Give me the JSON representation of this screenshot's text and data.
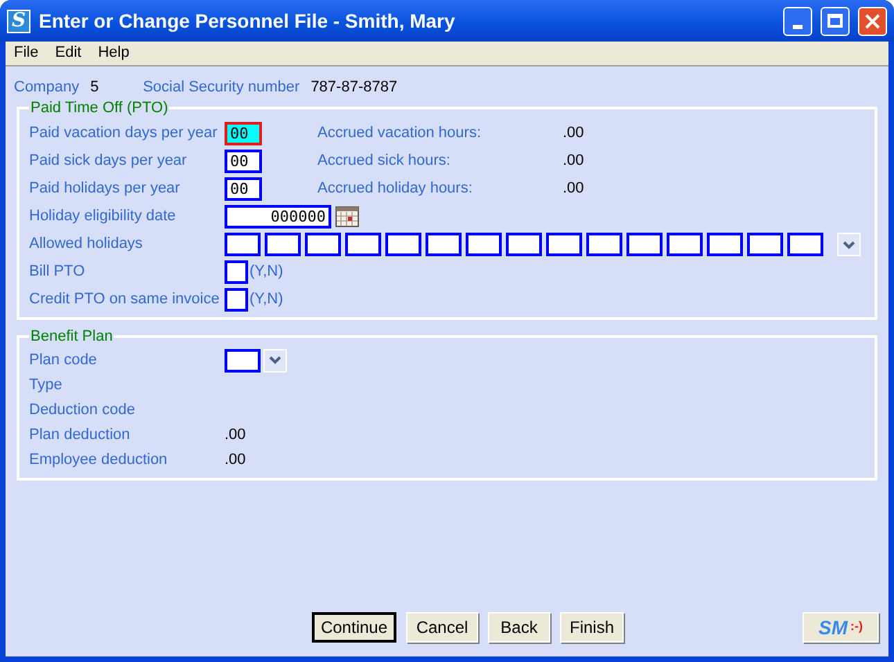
{
  "window": {
    "icon_letter": "S",
    "title": "Enter or Change Personnel File - Smith, Mary"
  },
  "menu": [
    "File",
    "Edit",
    "Help"
  ],
  "header": [
    {
      "label": "Company",
      "value": "5"
    },
    {
      "label": "Social Security number",
      "value": "787-87-8787"
    }
  ],
  "pto": {
    "title": "Paid Time Off (PTO)",
    "day_fields": [
      {
        "label": "Paid vacation days per year",
        "value": "00",
        "focused": true,
        "accrued_label": "Accrued vacation hours:",
        "accrued_value": ".00"
      },
      {
        "label": "Paid sick days per year",
        "value": "00",
        "focused": false,
        "accrued_label": "Accrued sick hours:",
        "accrued_value": ".00"
      },
      {
        "label": "Paid holidays per year",
        "value": "00",
        "focused": false,
        "accrued_label": "Accrued holiday hours:",
        "accrued_value": ".00"
      }
    ],
    "eligibility": {
      "label": "Holiday eligibility date",
      "value": "000000"
    },
    "allowed_holidays": {
      "label": "Allowed holidays",
      "fields": [
        {
          "focused": false
        },
        {
          "focused": false
        },
        {
          "focused": false
        },
        {
          "focused": false
        },
        {
          "focused": false
        },
        {
          "focused": false
        },
        {
          "focused": false
        },
        {
          "focused": false
        },
        {
          "focused": false
        },
        {
          "focused": false
        },
        {
          "focused": false
        },
        {
          "focused": false
        },
        {
          "focused": false
        },
        {
          "focused": false
        },
        {
          "focused": false
        }
      ]
    },
    "yn_fields": [
      {
        "label": "Bill PTO",
        "hint": "(Y,N)"
      },
      {
        "label": "Credit PTO on same invoice",
        "hint": "(Y,N)"
      }
    ]
  },
  "benefit": {
    "title": "Benefit Plan",
    "rows": [
      {
        "kind": "dropdown",
        "label": "Plan code"
      },
      {
        "kind": "text",
        "label": "Type"
      },
      {
        "kind": "text",
        "label": "Deduction code"
      },
      {
        "kind": "text",
        "label": "Plan deduction",
        "value": ".00"
      },
      {
        "kind": "text",
        "label": "Employee deduction",
        "value": ".00"
      }
    ]
  },
  "buttons": [
    {
      "label": "Continue",
      "default": true
    },
    {
      "label": "Cancel",
      "default": false
    },
    {
      "label": "Back",
      "default": false
    },
    {
      "label": "Finish",
      "default": false
    }
  ],
  "logo": {
    "letters": "SM",
    "smiley": ":-)"
  }
}
